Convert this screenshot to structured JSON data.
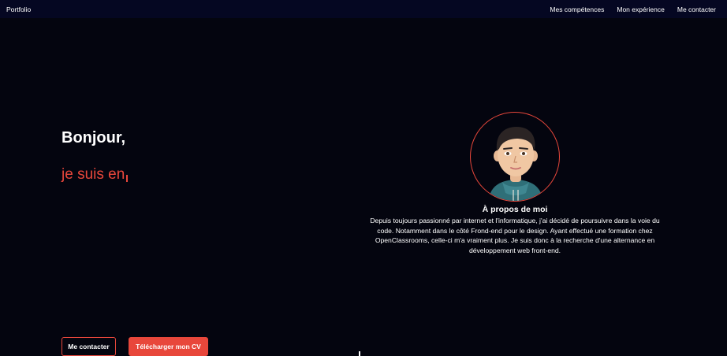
{
  "nav": {
    "brand": "Portfolio",
    "links": [
      "Mes compétences",
      "Mon expérience",
      "Me contacter"
    ]
  },
  "hero": {
    "greeting": "Bonjour,",
    "typed_text": "je suis en",
    "accent_color": "#e8473b"
  },
  "about": {
    "title": "À propos de moi",
    "text": "Depuis toujours passionné par internet et l'informatique, j'ai décidé de poursuivre dans la voie du code. Notamment dans le côté Frond-end pour le design. Ayant effectué une formation chez OpenClassrooms, celle-ci m'a vraiment plus. Je suis donc à la recherche d'une alternance en développement web front-end."
  },
  "buttons": {
    "contact": "Me contacter",
    "cv": "Télécharger mon CV"
  },
  "colors": {
    "background": "#04050f",
    "navbar": "#050722",
    "accent": "#e8473b"
  }
}
